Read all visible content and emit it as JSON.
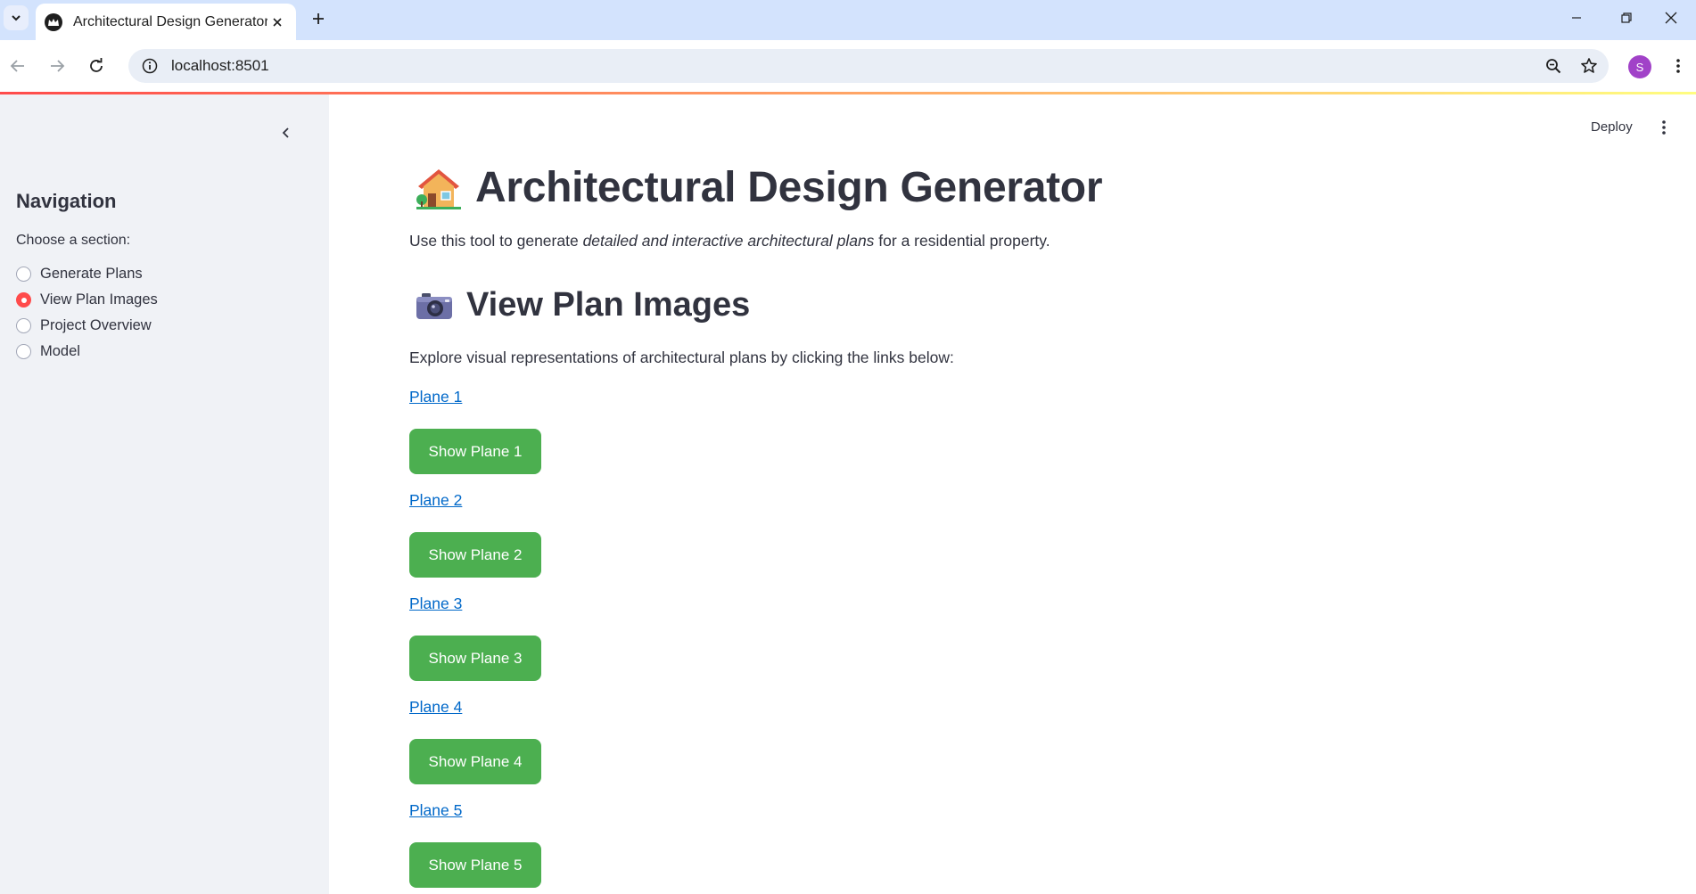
{
  "browser": {
    "tab_title": "Architectural Design Generator",
    "url": "localhost:8501",
    "profile_initial": "S"
  },
  "sidebar": {
    "title": "Navigation",
    "radio_label": "Choose a section:",
    "options": [
      "Generate Plans",
      "View Plan Images",
      "Project Overview",
      "Model"
    ],
    "selected": "View Plan Images"
  },
  "header": {
    "deploy_label": "Deploy"
  },
  "main": {
    "title": "Architectural Design Generator",
    "title_icon": "house-emoji",
    "intro_prefix": "Use this tool to generate ",
    "intro_emphasis": "detailed and interactive architectural plans",
    "intro_suffix": " for a residential property.",
    "section_title": "View Plan Images",
    "section_icon": "camera-emoji",
    "section_description": "Explore visual representations of architectural plans by clicking the links below:",
    "planes": [
      {
        "link": "Plane 1",
        "button": "Show Plane 1"
      },
      {
        "link": "Plane 2",
        "button": "Show Plane 2"
      },
      {
        "link": "Plane 3",
        "button": "Show Plane 3"
      },
      {
        "link": "Plane 4",
        "button": "Show Plane 4"
      },
      {
        "link": "Plane 5",
        "button": "Show Plane 5"
      }
    ]
  },
  "colors": {
    "accent": "#ff4b4b",
    "button": "#4caf50",
    "link": "#0068c9",
    "sidebar_bg": "#f0f2f6",
    "tabbar_bg": "#d3e3fd"
  }
}
